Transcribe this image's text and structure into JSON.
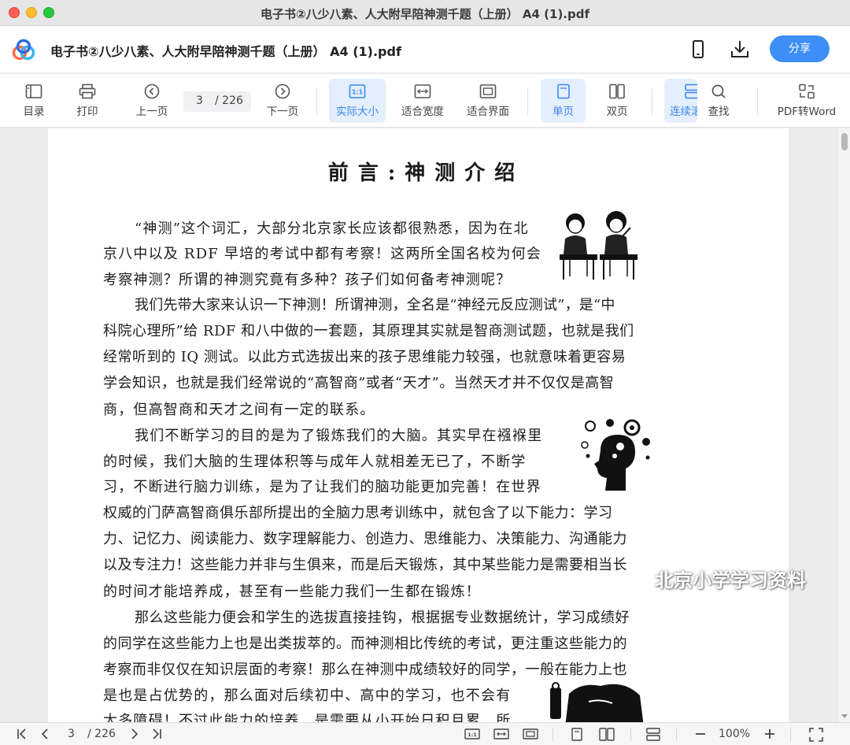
{
  "window": {
    "title": "电子书②八少八素、人大附早陪神测千题（上册） A4 (1).pdf"
  },
  "header": {
    "doc_title": "电子书②八少八素、人大附早陪神测千题（上册） A4 (1).pdf",
    "share_label": "分享",
    "icons": [
      "app-logo-icon",
      "phone-icon",
      "download-icon"
    ],
    "accent_color": "#3d8ef7"
  },
  "toolbar": {
    "toc": "目录",
    "print": "打印",
    "prev": "上一页",
    "current_page": "3",
    "total_pages": "/ 226",
    "next": "下一页",
    "actual_size": "实际大小",
    "fit_width": "适合宽度",
    "fit_page": "适合界面",
    "single_page": "单页",
    "double_page": "双页",
    "continuous": "连续滚",
    "search": "查找",
    "pdf_to_word": "PDF转Word"
  },
  "document": {
    "heading": "前言:神测介绍",
    "lines": [
      "“神测”这个词汇，大部分北京家长应该都很熟悉，因为在北",
      "京八中以及 RDF 早培的考试中都有考察！这两所全国名校为何会",
      "考察神测？所谓的神测究竟有多种？孩子们如何备考神测呢？",
      "我们先带大家来认识一下神测！所谓神测，全名是“神经元反应测试”，是“中",
      "科院心理所”给 RDF 和八中做的一套题，其原理其实就是智商测试题，也就是我们",
      "经常听到的 IQ 测试。以此方式选拔出来的孩子思维能力较强，也就意味着更容易",
      "学会知识，也就是我们经常说的“高智商”或者“天才”。当然天才并不仅仅是高智",
      "商，但高智商和天才之间有一定的联系。",
      "我们不断学习的目的是为了锻炼我们的大脑。其实早在襁褓里",
      "的时候，我们大脑的生理体积等与成年人就相差无已了，不断学",
      "习，不断进行脑力训练，是为了让我们的脑功能更加完善！在世界",
      "权威的门萨高智商俱乐部所提出的全脑力思考训练中，就包含了以下能力：学习",
      "力、记忆力、阅读能力、数字理解能力、创造力、思维能力、决策能力、沟通能力",
      "以及专注力！这些能力并非与生俱来，而是后天锻炼，其中某些能力是需要相当长",
      "的时间才能培养成，甚至有一些能力我们一生都在锻炼！",
      "那么这些能力便会和学生的选拔直接挂钩，根据据专业数据统计，学习成绩好",
      "的同学在这些能力上也是出类拔萃的。而神测相比传统的考试，更注重这些能力的",
      "考察而非仅仅在知识层面的考察！那么在神测中成绩较好的同学，一般在能力上也",
      "是也是占优势的，那么面对后续初中、高中的学习，也不会有",
      "太多障碍！不过此能力的培养，是需要从小开始日积月累，所"
    ],
    "watermark": "北京小学学习资料"
  },
  "statusbar": {
    "current_page": "3",
    "total_pages": "/ 226",
    "zoom": "100%"
  }
}
